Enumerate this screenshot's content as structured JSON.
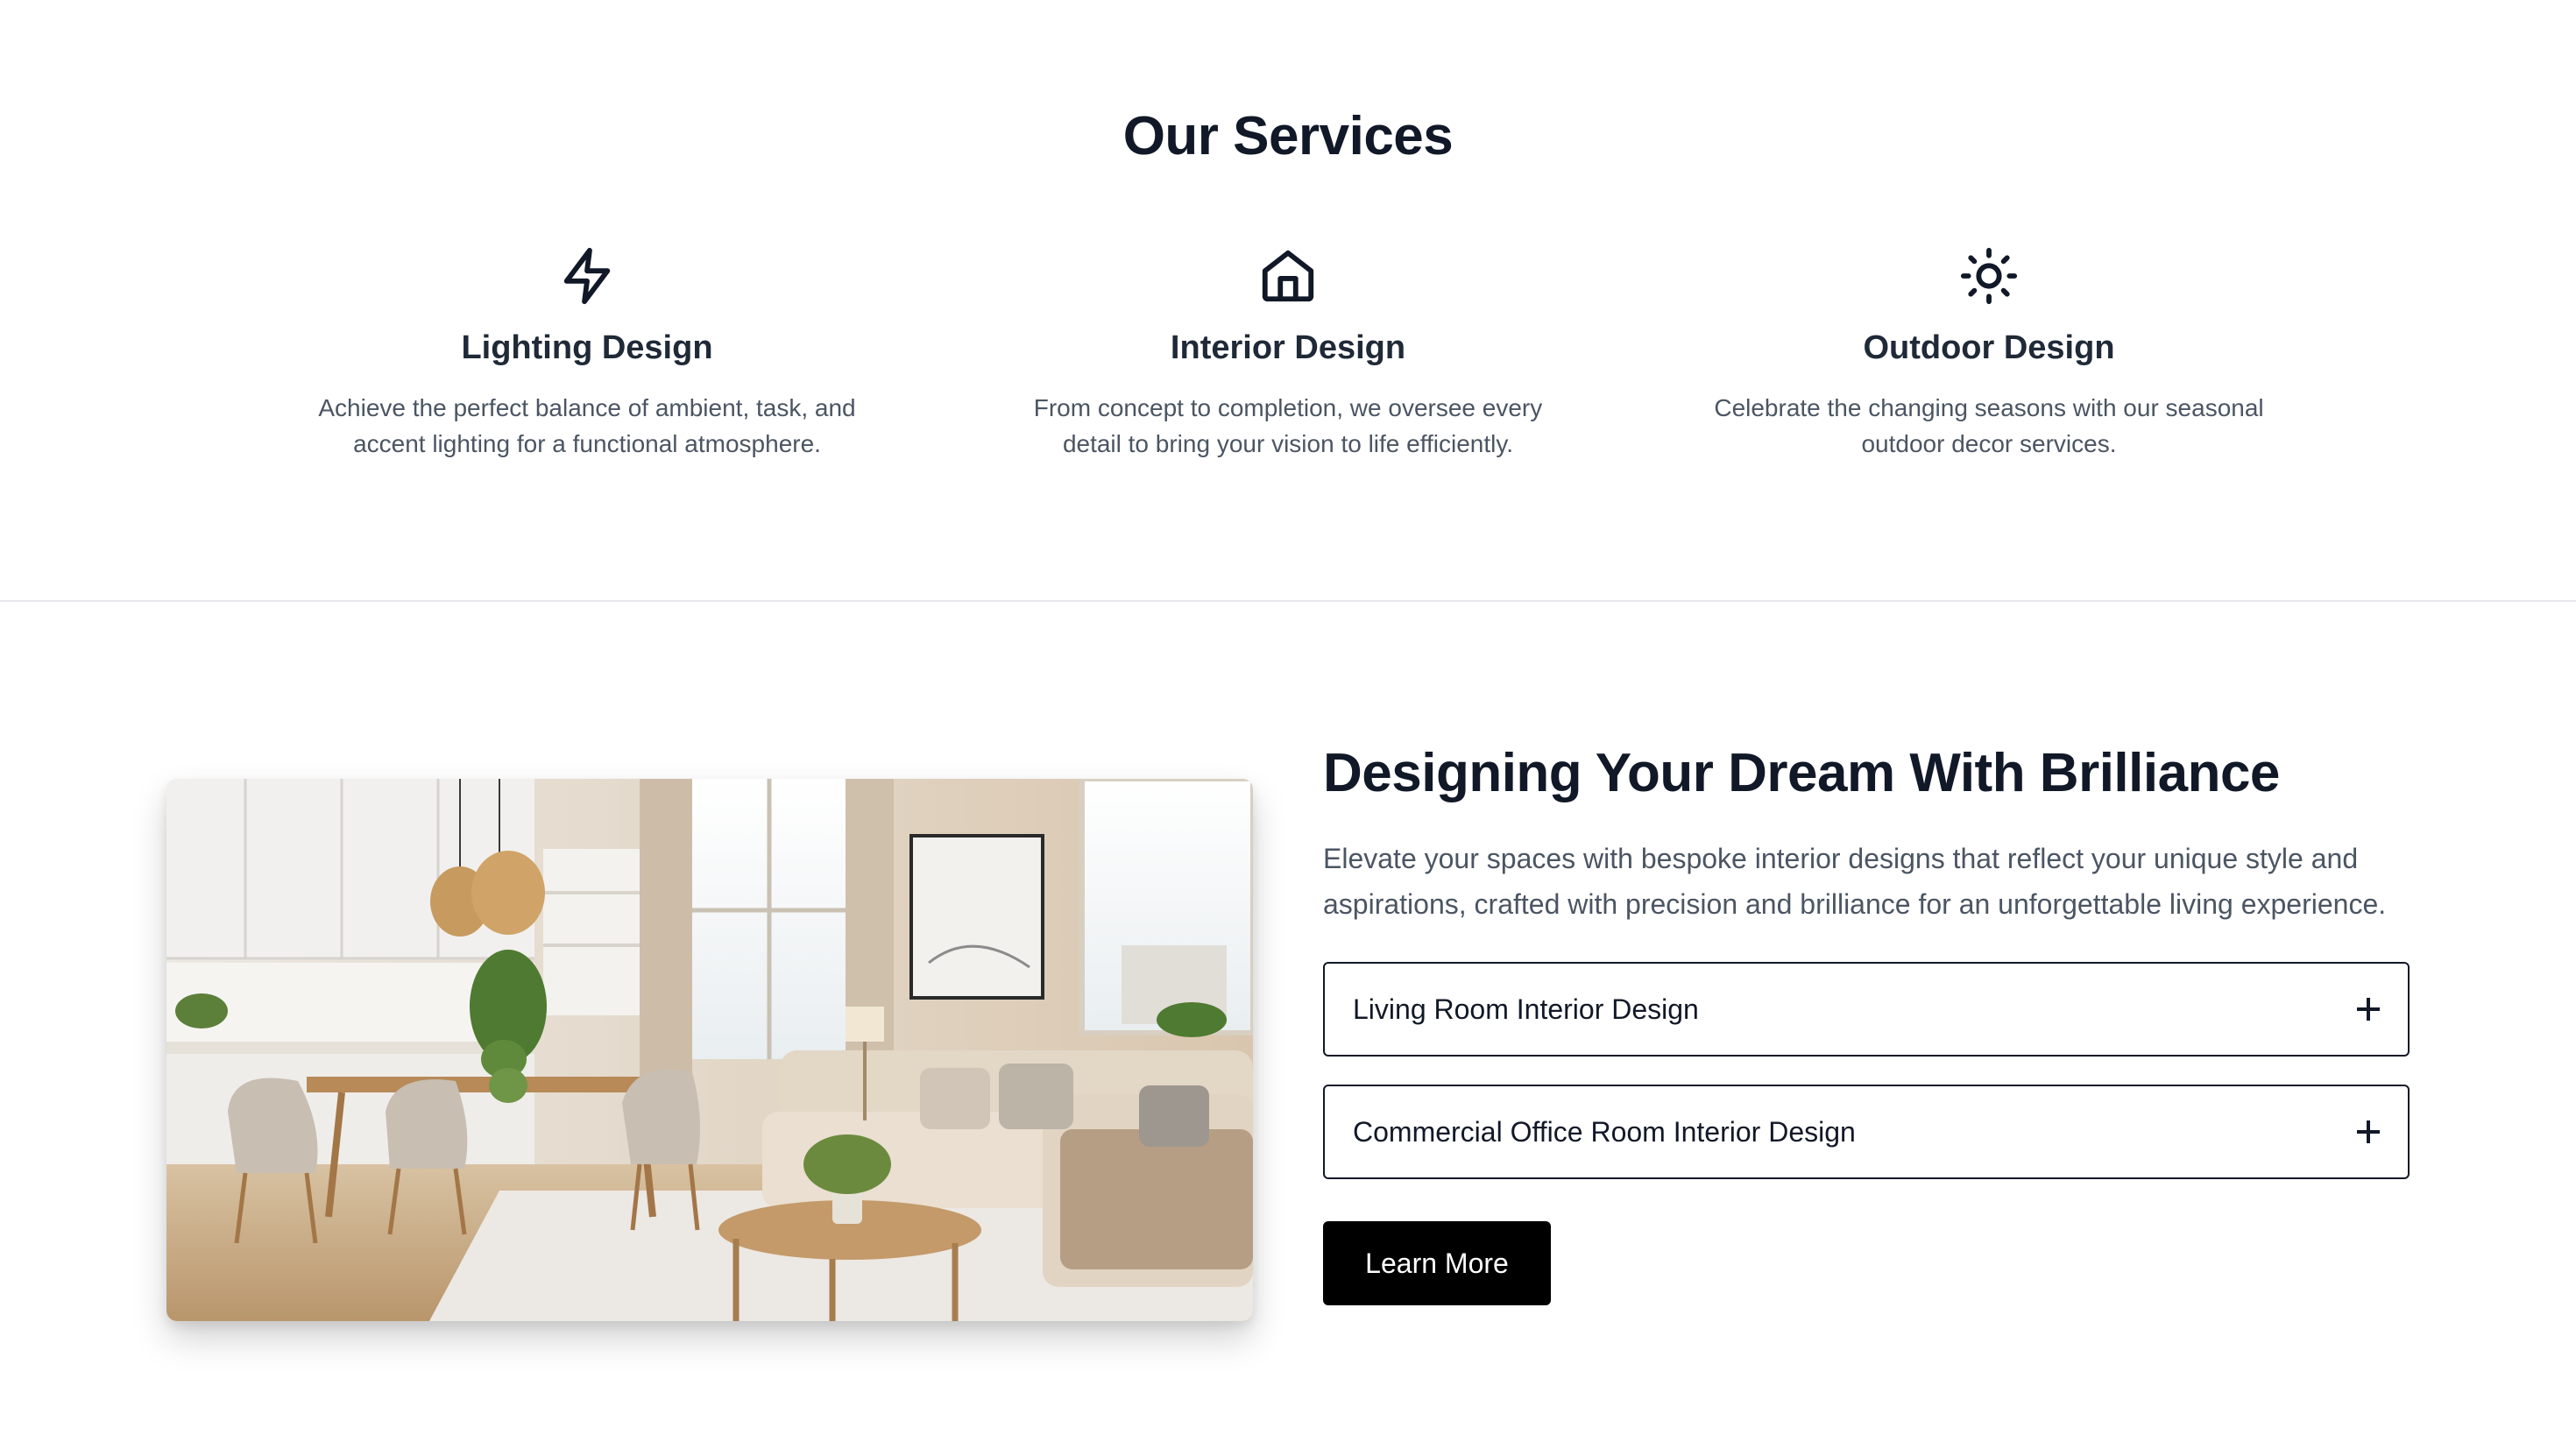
{
  "services": {
    "title": "Our Services",
    "items": [
      {
        "icon": "lightning-icon",
        "name": "Lighting Design",
        "description": "Achieve the perfect balance of ambient, task, and accent lighting for a functional atmosphere."
      },
      {
        "icon": "home-icon",
        "name": "Interior Design",
        "description": "From concept to completion, we oversee every detail to bring your vision to life efficiently."
      },
      {
        "icon": "sun-icon",
        "name": "Outdoor Design",
        "description": "Celebrate the changing seasons with our seasonal outdoor decor services."
      }
    ]
  },
  "dream": {
    "title": "Designing Your Dream With Brilliance",
    "text": "Elevate your spaces with bespoke interior designs that reflect your unique style and aspirations, crafted with precision and brilliance for an unforgettable living experience.",
    "accordions": [
      {
        "label": "Living Room Interior Design"
      },
      {
        "label": "Commercial Office Room Interior Design"
      }
    ],
    "button_label": "Learn More"
  }
}
